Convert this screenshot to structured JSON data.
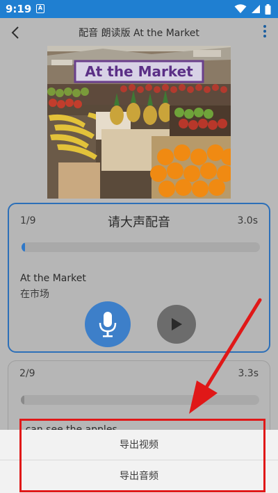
{
  "status_bar": {
    "time": "9:19",
    "notification_glyph": "A",
    "icons": [
      "wifi-icon",
      "signal-icon",
      "battery-icon"
    ]
  },
  "header": {
    "title": "配音 朗读版 At the Market",
    "back_icon": "back-arrow-icon",
    "menu_icon": "more-vertical-icon"
  },
  "cover": {
    "title_text": "At the Market"
  },
  "cards": [
    {
      "index": "1/9",
      "prompt": "请大声配音",
      "duration": "3.0s",
      "progress": 0.01,
      "sentence_en": "At the Market",
      "sentence_zh": "在市场",
      "record_icon": "microphone-icon",
      "play_icon": "play-icon"
    },
    {
      "index": "2/9",
      "duration": "3.3s",
      "progress": 0.01,
      "sentence_en": "I can see the apples."
    }
  ],
  "bottom_sheet": {
    "options": [
      "导出视频",
      "导出音频"
    ]
  },
  "colors": {
    "status_bar": "#1f7fd1",
    "accent": "#2c6fb8",
    "highlight": "#e01818"
  }
}
